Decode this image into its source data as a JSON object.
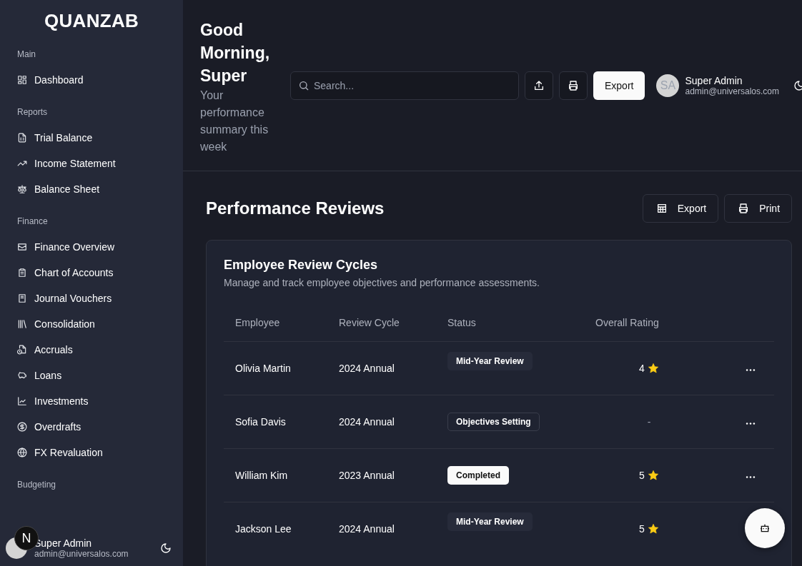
{
  "sidebar": {
    "logo": "QUANZAB",
    "sections": [
      {
        "title": "Main",
        "items": [
          {
            "label": "Dashboard"
          }
        ]
      },
      {
        "title": "Reports",
        "items": [
          {
            "label": "Trial Balance"
          },
          {
            "label": "Income Statement"
          },
          {
            "label": "Balance Sheet"
          }
        ]
      },
      {
        "title": "Finance",
        "items": [
          {
            "label": "Finance Overview"
          },
          {
            "label": "Chart of Accounts"
          },
          {
            "label": "Journal Vouchers"
          },
          {
            "label": "Consolidation"
          },
          {
            "label": "Accruals"
          },
          {
            "label": "Loans"
          },
          {
            "label": "Investments"
          },
          {
            "label": "Overdrafts"
          },
          {
            "label": "FX Revaluation"
          }
        ]
      },
      {
        "title": "Budgeting"
      }
    ],
    "user": {
      "name": "Super Admin",
      "email": "admin@universalos.com"
    },
    "dev_badge": "N"
  },
  "header": {
    "greeting": "Good Morning, Super",
    "subtitle": "Your performance summary this week",
    "search": {
      "placeholder": "Search..."
    },
    "export_button": "Export",
    "user": {
      "initials": "SA",
      "name": "Super Admin",
      "email": "admin@universalos.com"
    }
  },
  "page": {
    "title": "Performance Reviews",
    "actions": [
      "Export",
      "Print"
    ]
  },
  "card": {
    "title": "Employee Review Cycles",
    "description": "Manage and track employee objectives and performance assessments.",
    "table": {
      "columns": [
        "Employee",
        "Review Cycle",
        "Status",
        "Overall Rating"
      ],
      "rows": [
        {
          "employee": "Olivia Martin",
          "cycle": "2024 Annual",
          "status": {
            "label": "Mid-Year Review",
            "kind": "secondary"
          },
          "rating": "4",
          "starred": true
        },
        {
          "employee": "Sofia Davis",
          "cycle": "2024 Annual",
          "status": {
            "label": "Objectives Setting",
            "kind": "outline"
          },
          "rating": "-",
          "starred": false
        },
        {
          "employee": "William Kim",
          "cycle": "2023 Annual",
          "status": {
            "label": "Completed",
            "kind": "default"
          },
          "rating": "5",
          "starred": true
        },
        {
          "employee": "Jackson Lee",
          "cycle": "2024 Annual",
          "status": {
            "label": "Mid-Year Review",
            "kind": "secondary"
          },
          "rating": "5",
          "starred": true
        }
      ]
    }
  }
}
